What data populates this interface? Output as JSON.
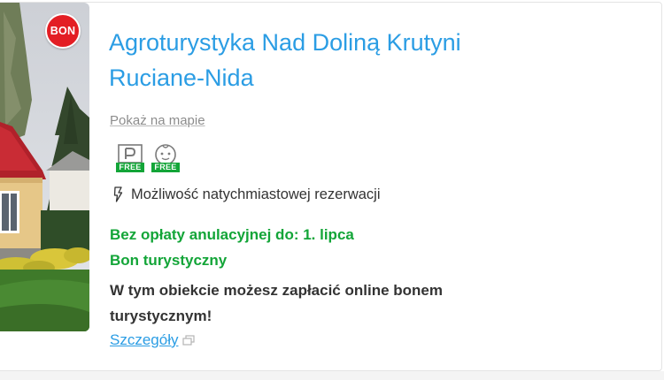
{
  "listing": {
    "badge": "BON",
    "title_line1": "Agroturystyka Nad Doliną Krutyni",
    "title_line2": "Ruciane-Nida",
    "map_link": "Pokaż na mapie",
    "amenities": [
      {
        "icon": "parking-icon",
        "tag": "FREE"
      },
      {
        "icon": "baby-icon",
        "tag": "FREE"
      }
    ],
    "instant_booking": "Możliwość natychmiastowej rezerwacji",
    "free_cancellation": "Bez opłaty anulacyjnej do: 1. lipca",
    "bon_title": "Bon turystyczny",
    "bon_description": "W tym obiekcie możesz zapłacić online bonem turystycznym!",
    "details_link": "Szczegóły"
  },
  "colors": {
    "link_blue": "#2b9de4",
    "green": "#13a538",
    "badge_red": "#e31e24",
    "text": "#333333",
    "muted": "#8c8c8c"
  }
}
